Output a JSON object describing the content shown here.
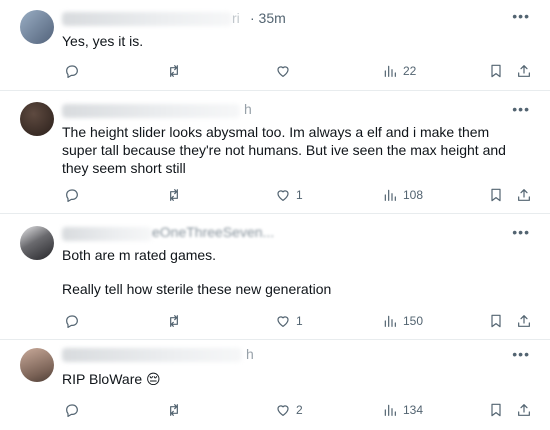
{
  "posts": [
    {
      "id": "post-1",
      "author_suffix": "ri",
      "time": "· 35m",
      "text": [
        "Yes, yes it is."
      ],
      "likes": "",
      "views": "22",
      "avatar": {
        "colors": [
          "#8fa2b8",
          "#5a6a80"
        ]
      }
    },
    {
      "id": "post-2",
      "author_suffix": "h",
      "time": "",
      "text": [
        "The height slider looks abysmal too. Im always a elf and i make them super tall because they're not humans. But ive seen the max height and they seem short still"
      ],
      "likes": "1",
      "views": "108",
      "avatar": {
        "colors": [
          "#4a3a32",
          "#2a211c"
        ]
      }
    },
    {
      "id": "post-3",
      "author_suffix": "eOneThreeSeven...",
      "time": "",
      "text": [
        "Both are m rated games.",
        "Really tell how sterile these new generation"
      ],
      "likes": "1",
      "views": "150",
      "avatar": {
        "colors": [
          "#6a6a6e",
          "#2e2e32"
        ]
      }
    },
    {
      "id": "post-4",
      "author_suffix": "h",
      "time": "",
      "text": [
        "RIP BloWare 😔"
      ],
      "likes": "2",
      "views": "134",
      "avatar": {
        "colors": [
          "#b89a8c",
          "#7a6256"
        ]
      }
    }
  ],
  "icons": {
    "more": "more-options-icon",
    "reply": "reply-icon",
    "repost": "repost-icon",
    "like": "like-icon",
    "views": "views-icon",
    "bookmark": "bookmark-icon",
    "share": "share-icon"
  },
  "more_glyph": "•••"
}
